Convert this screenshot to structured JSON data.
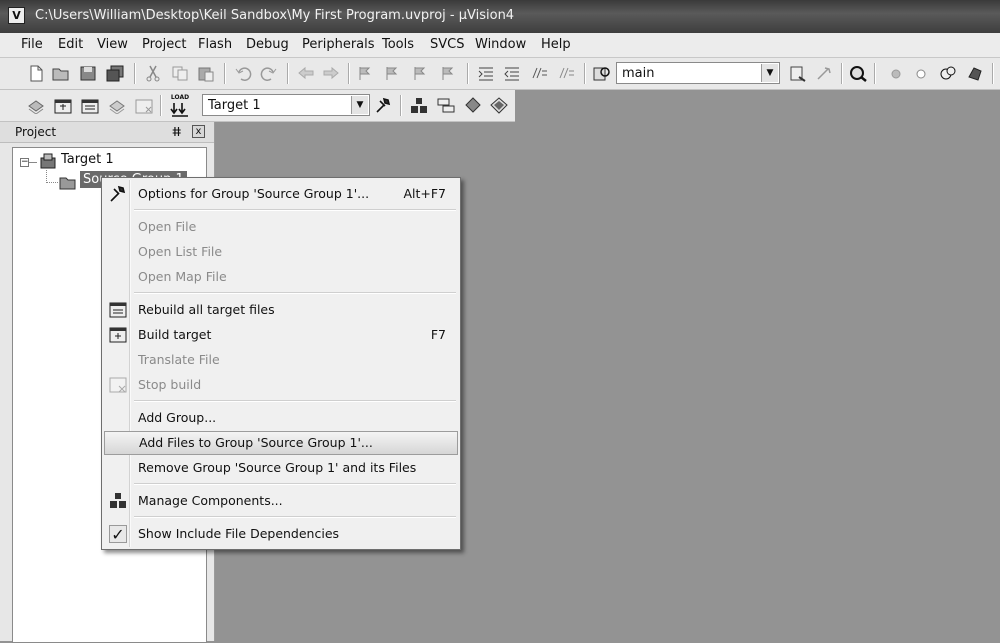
{
  "window": {
    "title": "C:\\Users\\William\\Desktop\\Keil Sandbox\\My First Program.uvproj - µVision4",
    "app_icon": "V"
  },
  "menu": [
    "File",
    "Edit",
    "View",
    "Project",
    "Flash",
    "Debug",
    "Peripherals",
    "Tools",
    "SVCS",
    "Window",
    "Help"
  ],
  "toolbar": {
    "find_combo_value": "main",
    "target_combo_value": "Target 1",
    "load_label": "LOAD"
  },
  "project_panel": {
    "title": "Project",
    "pin_glyph": "ⵌ",
    "close_glyph": "x"
  },
  "tree": {
    "target_label": "Target 1",
    "group_label": "Source Group 1",
    "expand_glyph": "−"
  },
  "context_menu": {
    "options_group": {
      "label": "Options for Group 'Source Group 1'...",
      "shortcut": "Alt+F7"
    },
    "open_file": {
      "label": "Open File"
    },
    "open_list_file": {
      "label": "Open List File"
    },
    "open_map_file": {
      "label": "Open Map File"
    },
    "rebuild_all": {
      "label": "Rebuild all target files"
    },
    "build_target": {
      "label": "Build target",
      "shortcut": "F7"
    },
    "translate_file": {
      "label": "Translate File"
    },
    "stop_build": {
      "label": "Stop build"
    },
    "add_group": {
      "label": "Add Group..."
    },
    "add_files": {
      "label": "Add Files to Group 'Source Group 1'..."
    },
    "remove_group": {
      "label": "Remove Group 'Source Group 1' and its Files"
    },
    "manage_components": {
      "label": "Manage Components..."
    },
    "show_include_deps": {
      "label": "Show Include File Dependencies",
      "check_glyph": "✓"
    }
  }
}
